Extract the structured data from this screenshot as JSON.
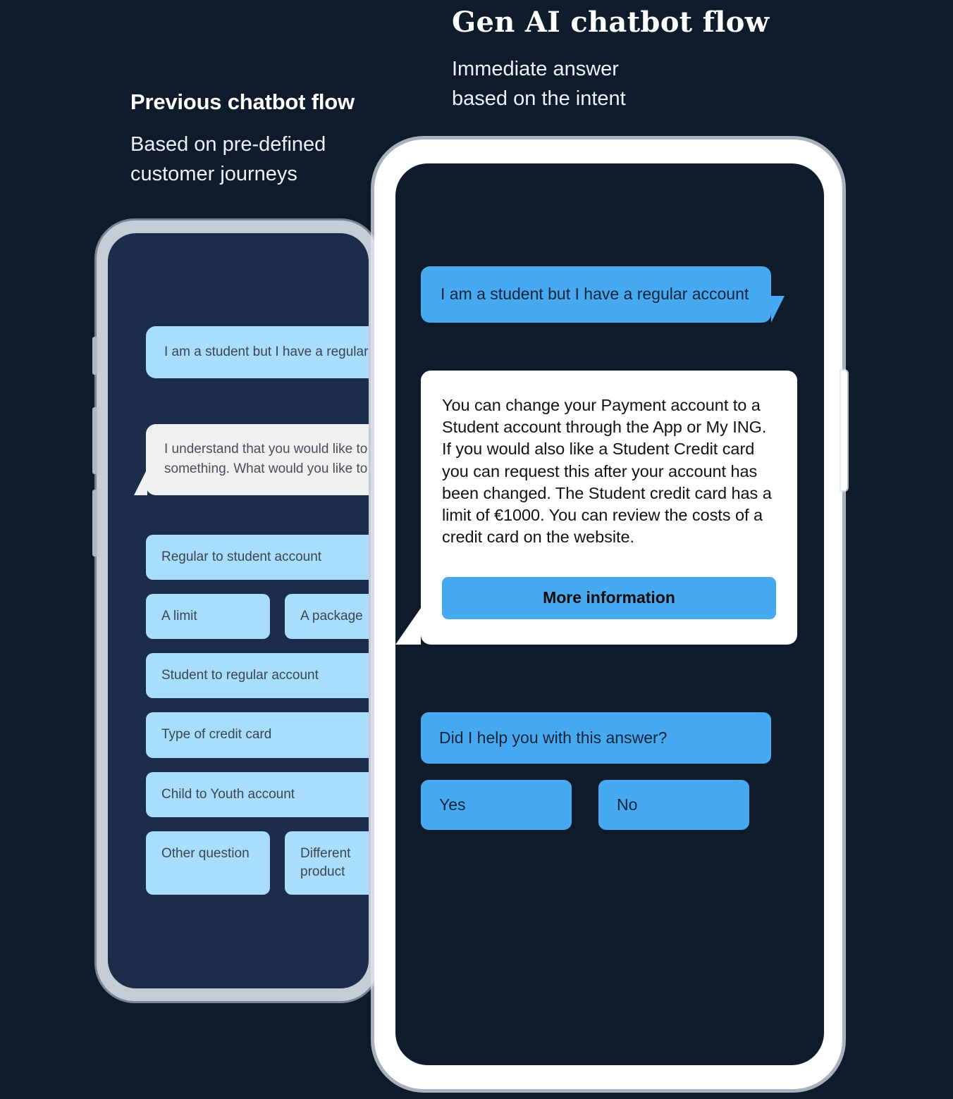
{
  "background_color": "#0d1b2a",
  "accent_blue": "#47a9ef",
  "light_blue": "#a8ddfb",
  "panels": {
    "left": {
      "title": "Previous chatbot flow",
      "subtitle_line1": "Based on pre-defined",
      "subtitle_line2": "customer journeys",
      "chat": {
        "user_message": "I am a student but I have a regular account",
        "bot_message_line1": "I understand that you would like to know",
        "bot_message_line2": "something. What would you like to do?",
        "options": [
          {
            "label": "Regular to student account",
            "size": "full"
          },
          {
            "label": "A limit",
            "size": "half"
          },
          {
            "label": "A package",
            "size": "half"
          },
          {
            "label": "Student to regular account",
            "size": "full"
          },
          {
            "label": "Type of credit card",
            "size": "full"
          },
          {
            "label": "Child to Youth account",
            "size": "full"
          },
          {
            "label": "Other question",
            "size": "half"
          },
          {
            "label": "Different product",
            "size": "half"
          }
        ]
      }
    },
    "right": {
      "title": "Gen AI chatbot flow",
      "subtitle_line1": "Immediate answer",
      "subtitle_line2": "based on the intent",
      "chat": {
        "user_message": "I am a student but I have a regular account",
        "bot_answer": "You can change your Payment account to a Student account through the App or My ING. If you would also like a Student Credit card you can request this after your account has been changed. The Student credit card has a limit of €1000. You can review the costs of a credit card on the website.",
        "more_information_label": "More information",
        "feedback_question": "Did I help you with this answer?",
        "feedback_yes": "Yes",
        "feedback_no": "No"
      }
    }
  }
}
